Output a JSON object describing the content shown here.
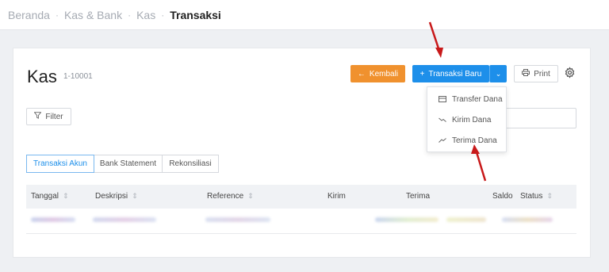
{
  "breadcrumb": {
    "items": [
      "Beranda",
      "Kas & Bank",
      "Kas"
    ],
    "current": "Transaksi"
  },
  "header": {
    "title": "Kas",
    "account_code": "1-10001"
  },
  "toolbar": {
    "back_label": "Kembali",
    "new_transaction_label": "Transaksi Baru",
    "print_label": "Print"
  },
  "filter": {
    "label": "Filter"
  },
  "dropdown": {
    "items": [
      {
        "label": "Transfer Dana",
        "icon": "card-icon"
      },
      {
        "label": "Kirim Dana",
        "icon": "trend-down-icon"
      },
      {
        "label": "Terima Dana",
        "icon": "trend-up-icon"
      }
    ]
  },
  "tabs": [
    "Transaksi Akun",
    "Bank Statement",
    "Rekonsiliasi"
  ],
  "table": {
    "columns": [
      "Tanggal",
      "Deskripsi",
      "Reference",
      "Kirim",
      "Terima",
      "Saldo",
      "Status"
    ]
  },
  "colors": {
    "primary": "#1d8fea",
    "back_button": "#f0912e",
    "annotation_arrow": "#c8191a"
  }
}
